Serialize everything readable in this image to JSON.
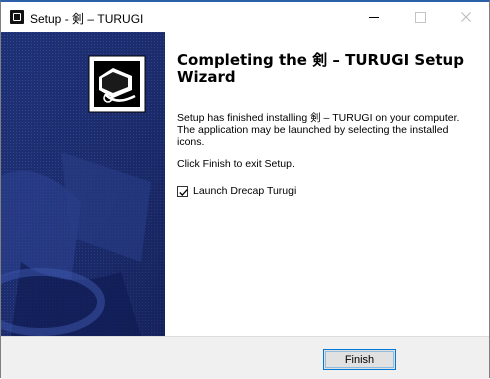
{
  "window": {
    "title": "Setup - 剣 – TURUGI",
    "minimize_glyph": "—",
    "maximize_glyph": "☐",
    "close_glyph": "✕"
  },
  "wizard": {
    "heading": "Completing the 剣 – TURUGI Setup Wizard",
    "paragraph1": "Setup has finished installing 剣 – TURUGI on your computer. The application may be launched by selecting the installed icons.",
    "paragraph2": "Click Finish to exit Setup.",
    "launch_checkbox": {
      "label": "Launch Drecap Turugi",
      "checked": true
    }
  },
  "footer": {
    "finish_label": "Finish"
  },
  "colors": {
    "sidebar_bg": "#1d2f72",
    "sidebar_accent": "#3a4f9e",
    "focus_border": "#0078d7",
    "title_accent": "#2b5fa8"
  },
  "icons": {
    "app": "setup-app-icon",
    "installer_logo": "computer-install-icon"
  }
}
